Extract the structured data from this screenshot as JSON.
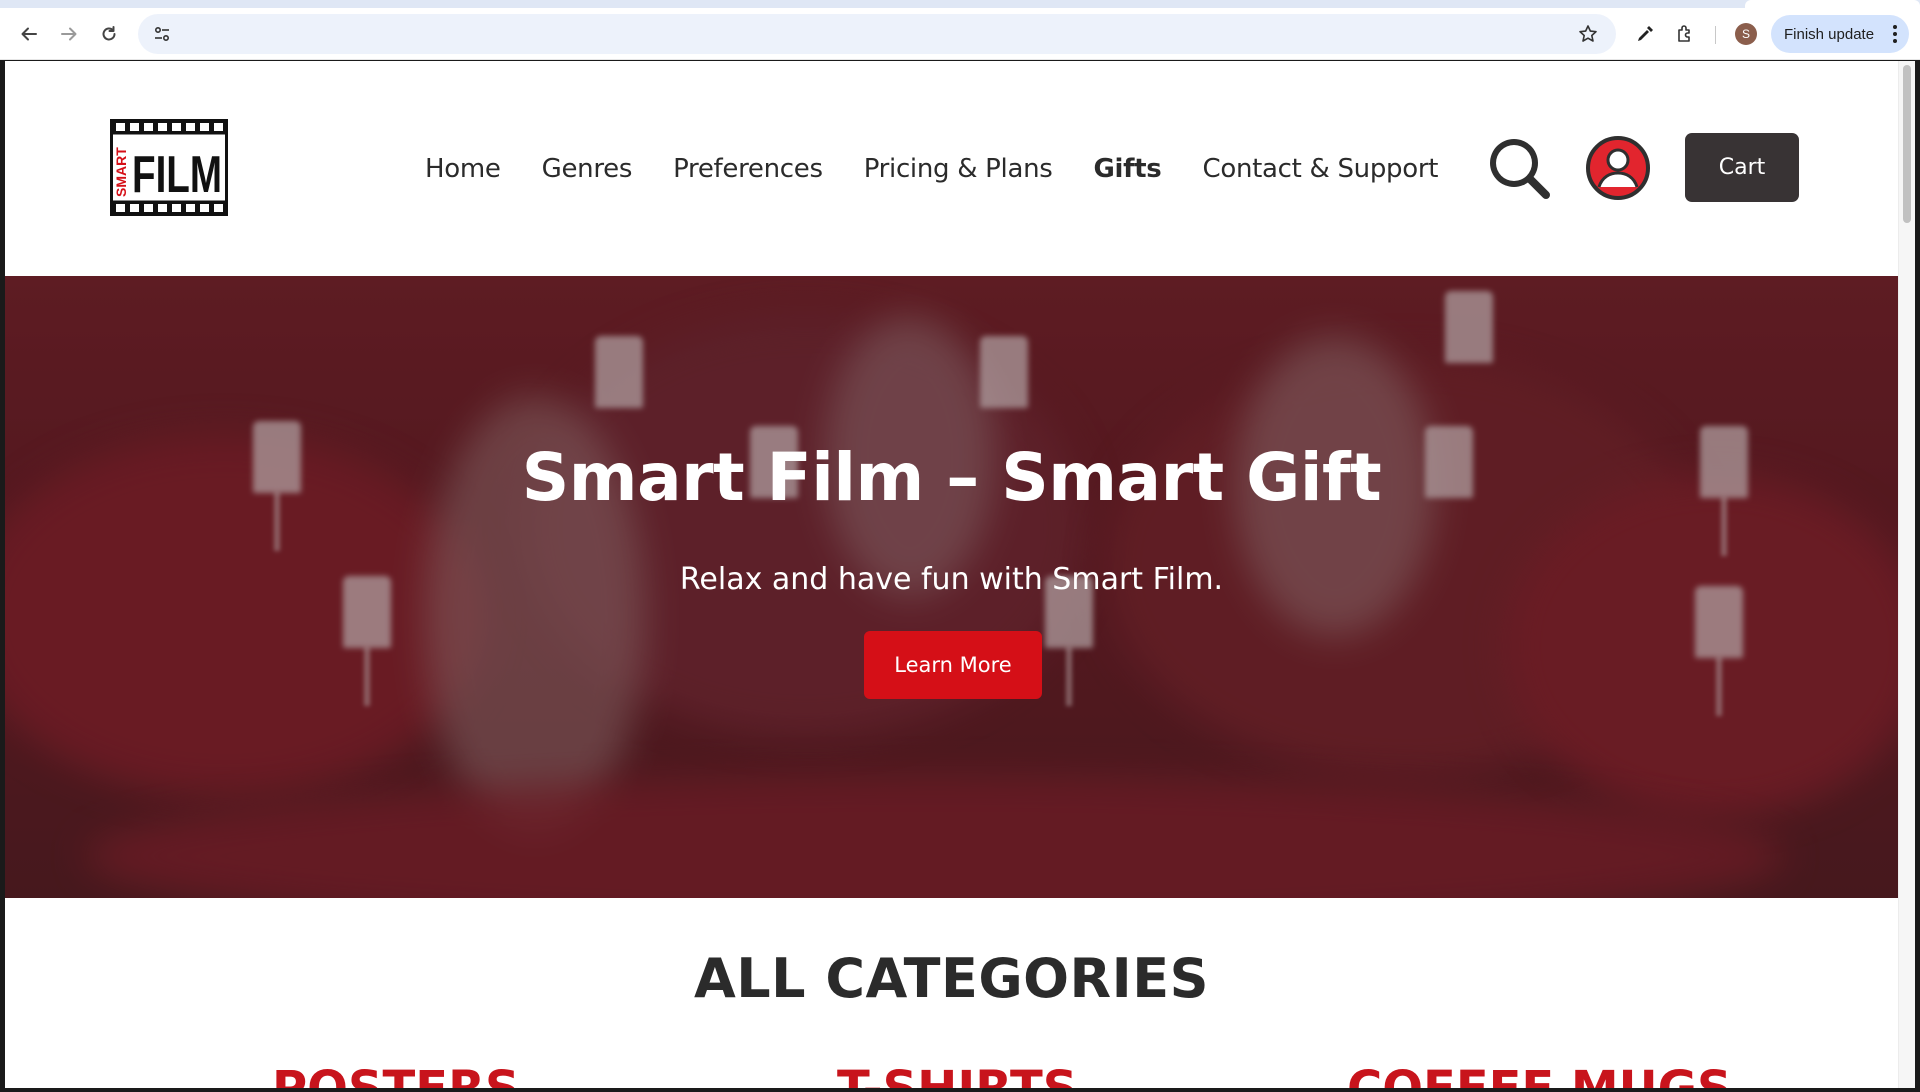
{
  "browser": {
    "finish_update_label": "Finish update",
    "profile_initial": "S",
    "icons": [
      "back-icon",
      "forward-icon",
      "reload-icon",
      "site-info-icon",
      "star-icon",
      "eyedropper-icon",
      "extensions-icon",
      "more-vert-icon"
    ]
  },
  "site": {
    "logo_text_small": "SMART",
    "logo_text_big": "FILM",
    "nav": {
      "home": "Home",
      "genres": "Genres",
      "preferences": "Preferences",
      "pricing": "Pricing & Plans",
      "gifts": "Gifts",
      "contact": "Contact & Support"
    },
    "active_nav": "Gifts",
    "cart_label": "Cart",
    "colors": {
      "brand_red": "#d50f17",
      "dark": "#383334",
      "category_red": "#c8141c"
    }
  },
  "hero": {
    "title": "Smart Film – Smart Gift",
    "subtitle": "Relax and have fun with Smart Film.",
    "button_label": "Learn More"
  },
  "categories": {
    "title": "ALL CATEGORIES",
    "items": [
      "POSTERS",
      "T-SHIRTS",
      "COFFEE MUGS"
    ]
  }
}
